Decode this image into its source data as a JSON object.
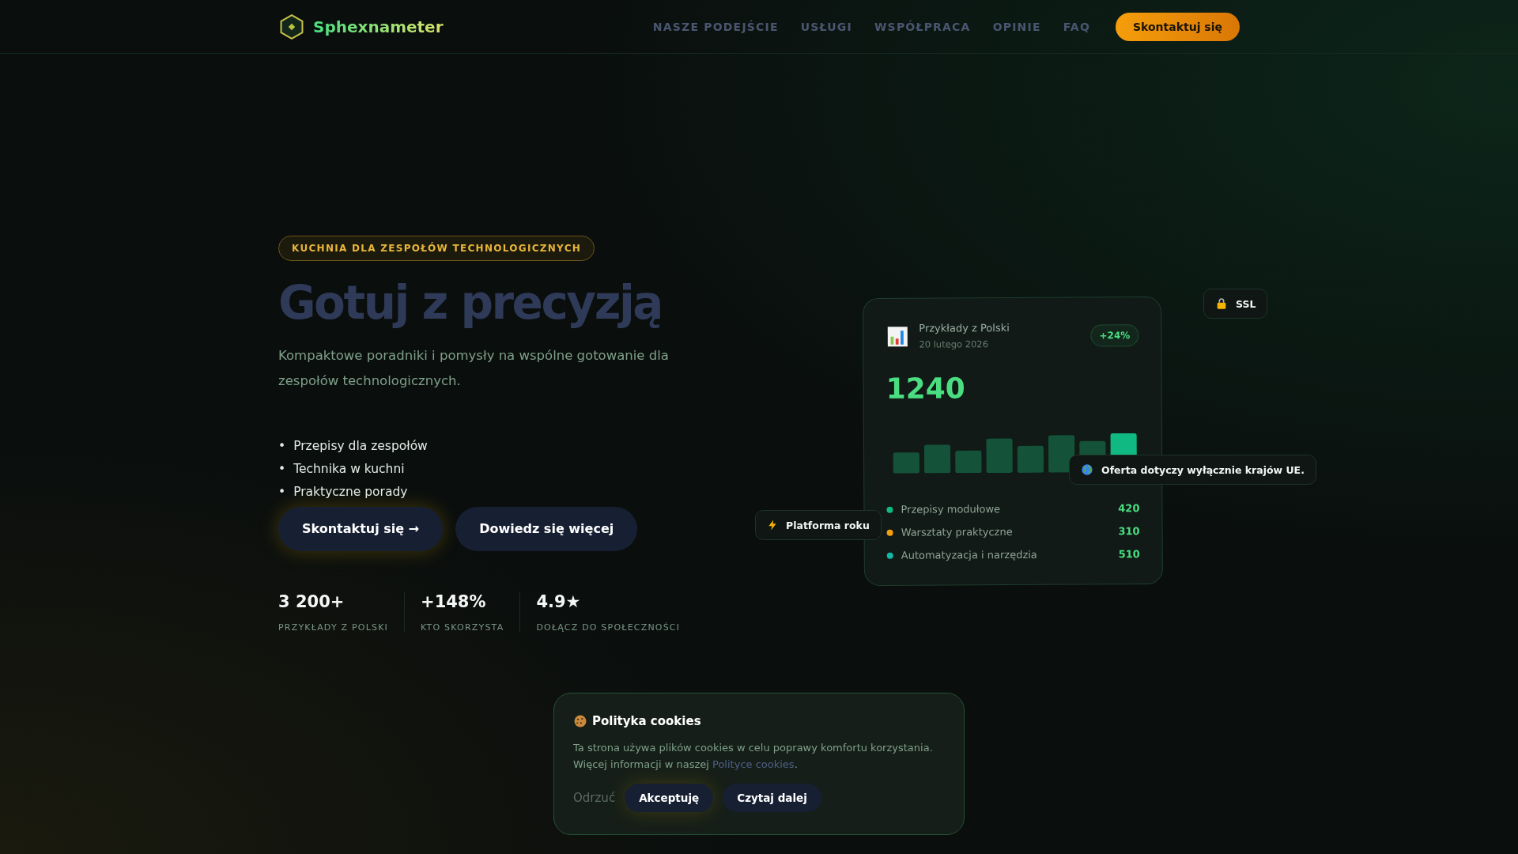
{
  "nav": {
    "brand": "Sphexnameter",
    "links": [
      {
        "label": "NASZE PODEJŚCIE"
      },
      {
        "label": "USŁUGI"
      },
      {
        "label": "WSPÓŁPRACA"
      },
      {
        "label": "OPINIE"
      },
      {
        "label": "FAQ"
      }
    ],
    "cta": "Skontaktuj się"
  },
  "hero": {
    "badge": "KUCHNIA DLA ZESPOŁÓW TECHNOLOGICZNYCH",
    "title": "Gotuj z precyzją",
    "subtitle": "Kompaktowe poradniki i pomysły na wspólne gotowanie dla zespołów technologicznych.",
    "marker": "•",
    "bullets": [
      "Przepisy dla zespołów",
      "Technika w kuchni",
      "Praktyczne porady"
    ],
    "buttons": [
      {
        "label": "Skontaktuj się →",
        "kind": "primary"
      },
      {
        "label": "Dowiedz się więcej",
        "kind": "secondary"
      }
    ],
    "stats": [
      {
        "value": "3 200+",
        "label": "PRZYKŁADY Z POLSKI"
      },
      {
        "value": "+148%",
        "label": "KTO SKORZYSTA"
      },
      {
        "value": "4.9★",
        "label": "DOŁĄCZ DO SPOŁECZNOŚCI"
      }
    ]
  },
  "card": {
    "title": "Przykłady z Polski",
    "date": "20 lutego 2026",
    "change": "+24%",
    "total": "1240",
    "legend": [
      {
        "label": "Przepisy modułowe",
        "value": "420",
        "color": "#10b981"
      },
      {
        "label": "Warsztaty praktyczne",
        "value": "310",
        "color": "#f59e0b"
      },
      {
        "label": "Automatyzacja i narzędzia",
        "value": "510",
        "color": "#14b8a6"
      }
    ]
  },
  "floating": {
    "ssl": "SSL",
    "platform": "Platforma roku",
    "offer": "Oferta dotyczy wyłącznie krajów UE."
  },
  "cookies": {
    "title": "Polityka cookies",
    "text": "Ta strona używa plików cookies w celu poprawy komfortu korzystania. Więcej informacji w naszej",
    "link": "Polityce cookies",
    "after": ".",
    "reject": "Odrzuć",
    "accept": "Akceptuję",
    "more": "Czytaj dalej"
  }
}
